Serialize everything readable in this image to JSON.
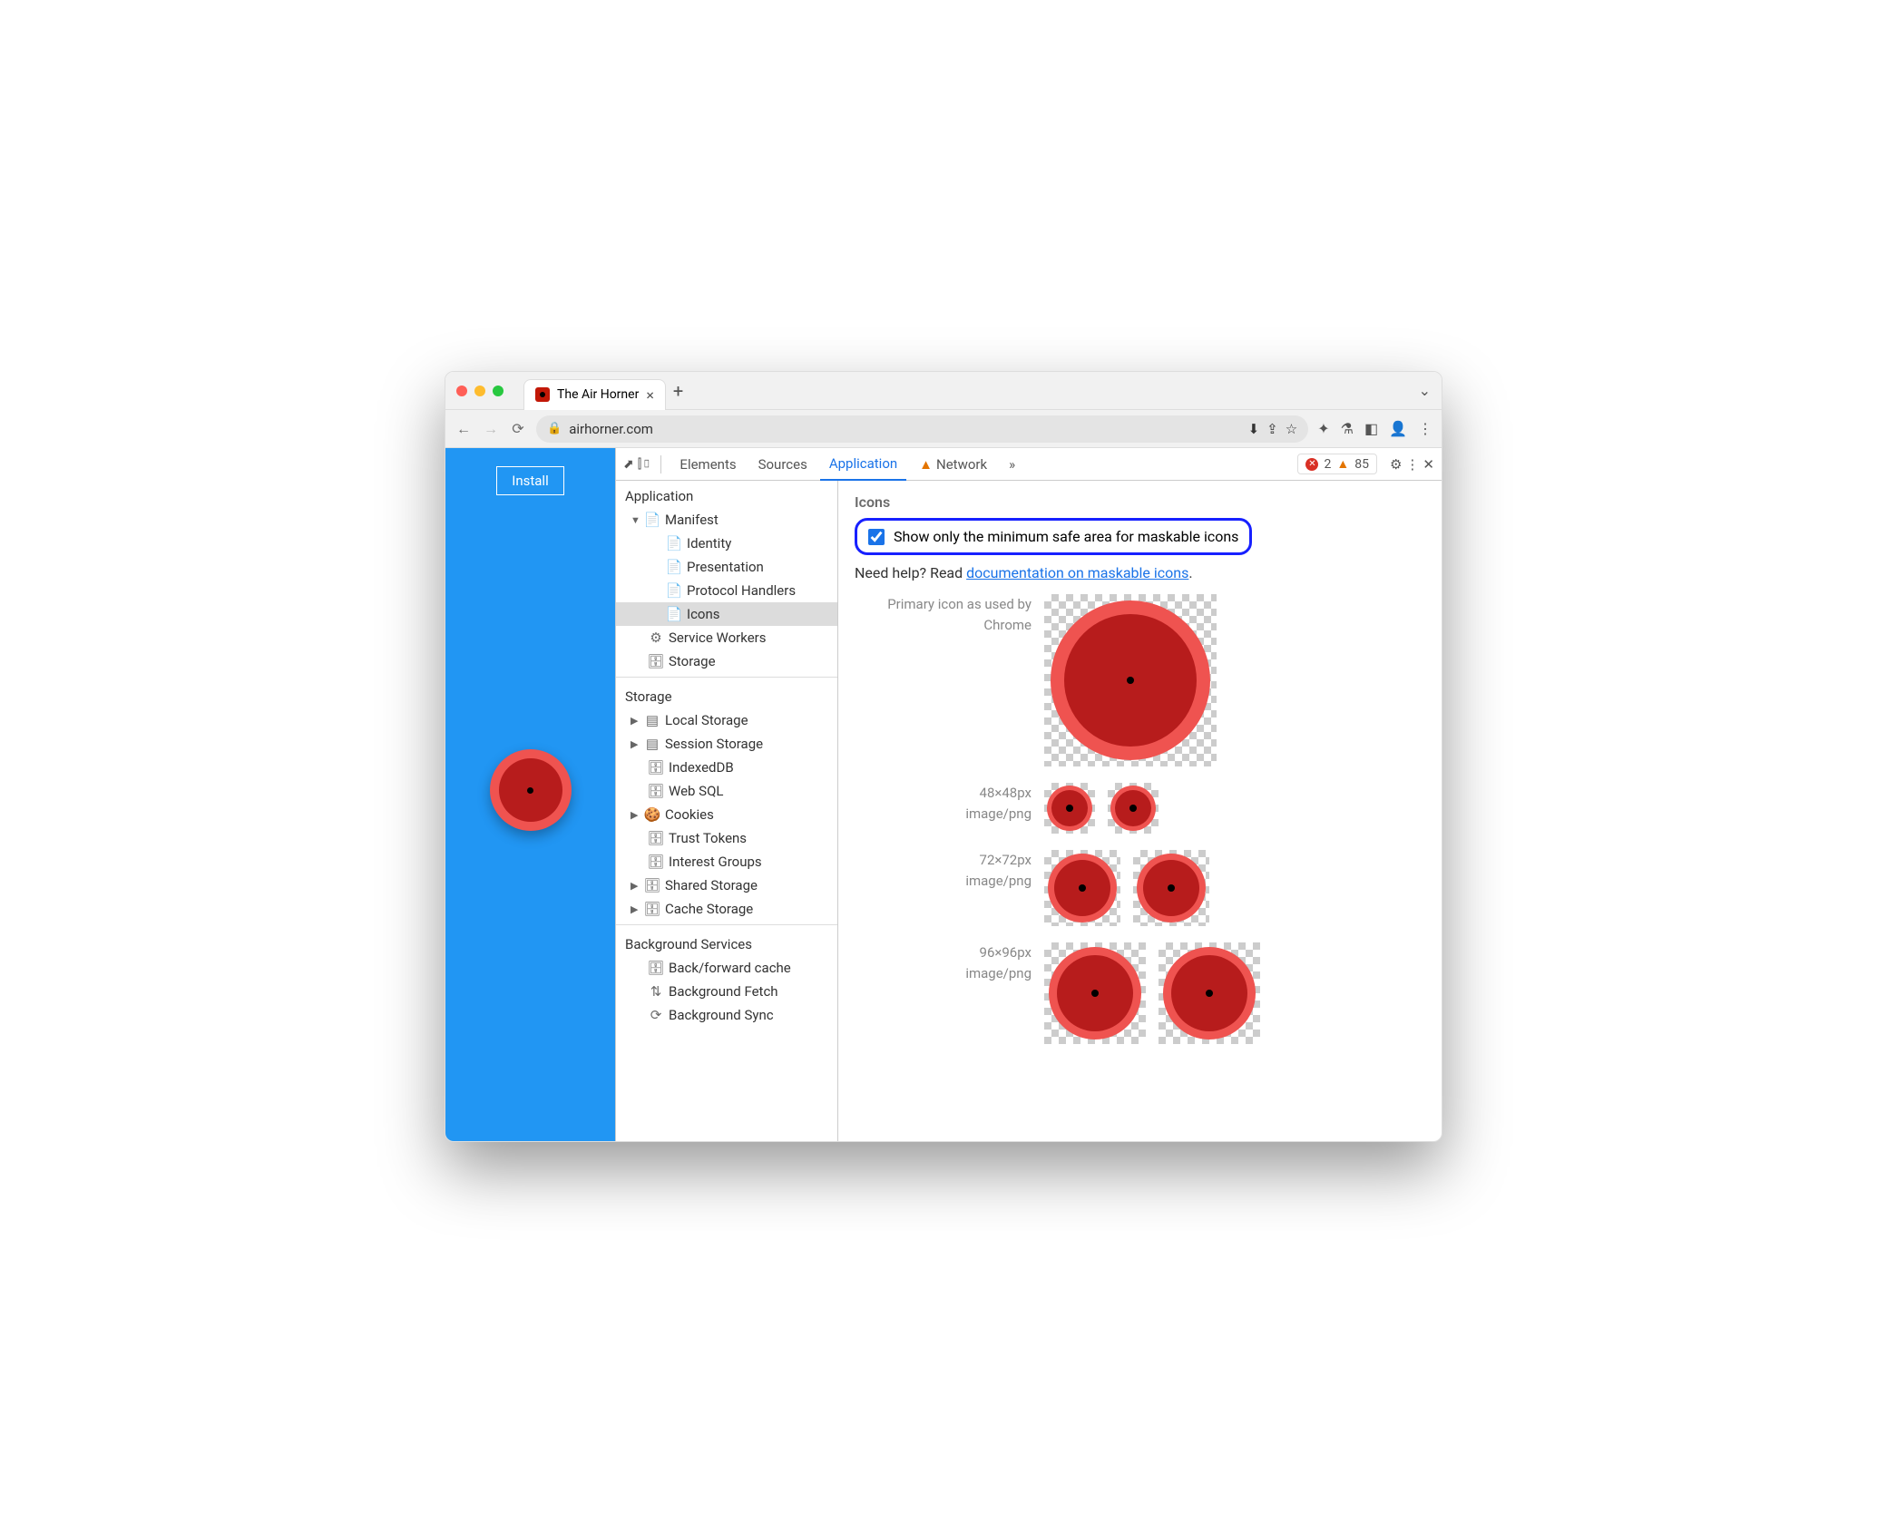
{
  "browser": {
    "tab_title": "The Air Horner",
    "url": "airhorner.com",
    "errors": "2",
    "warnings": "85"
  },
  "page": {
    "install_label": "Install"
  },
  "devtools": {
    "tabs": {
      "elements": "Elements",
      "sources": "Sources",
      "application": "Application",
      "network": "Network"
    },
    "sidebar": {
      "application": "Application",
      "manifest": "Manifest",
      "identity": "Identity",
      "presentation": "Presentation",
      "protocol_handlers": "Protocol Handlers",
      "icons": "Icons",
      "service_workers": "Service Workers",
      "storage_node": "Storage",
      "storage": "Storage",
      "local_storage": "Local Storage",
      "session_storage": "Session Storage",
      "indexeddb": "IndexedDB",
      "web_sql": "Web SQL",
      "cookies": "Cookies",
      "trust_tokens": "Trust Tokens",
      "interest_groups": "Interest Groups",
      "shared_storage": "Shared Storage",
      "cache_storage": "Cache Storage",
      "background_services": "Background Services",
      "bf_cache": "Back/forward cache",
      "bg_fetch": "Background Fetch",
      "bg_sync": "Background Sync"
    },
    "panel": {
      "heading": "Icons",
      "checkbox_label": "Show only the minimum safe area for maskable icons",
      "help_prefix": "Need help? Read ",
      "help_link": "documentation on maskable icons",
      "primary_label_1": "Primary icon as used by",
      "primary_label_2": "Chrome",
      "rows": [
        {
          "size": "48×48px",
          "mime": "image/png"
        },
        {
          "size": "72×72px",
          "mime": "image/png"
        },
        {
          "size": "96×96px",
          "mime": "image/png"
        }
      ]
    }
  }
}
